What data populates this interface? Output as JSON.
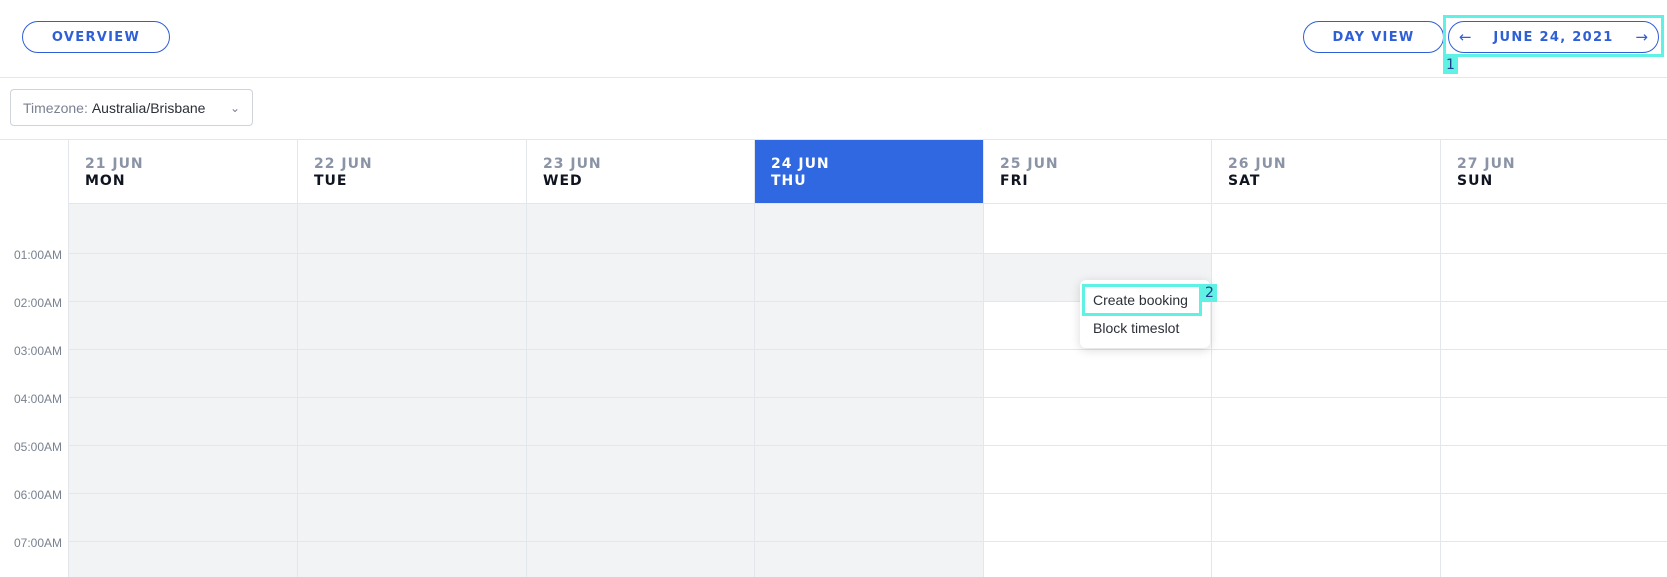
{
  "header": {
    "overview_label": "OVERVIEW",
    "dayview_label": "DAY VIEW",
    "date_label": "JUNE 24, 2021",
    "prev_arrow": "←",
    "next_arrow": "→"
  },
  "timezone": {
    "label": "Timezone:",
    "value": "Australia/Brisbane",
    "chevron": "⌄"
  },
  "days": [
    {
      "date": "21 JUN",
      "weekday": "MON"
    },
    {
      "date": "22 JUN",
      "weekday": "TUE"
    },
    {
      "date": "23 JUN",
      "weekday": "WED"
    },
    {
      "date": "24 JUN",
      "weekday": "THU"
    },
    {
      "date": "25 JUN",
      "weekday": "FRI"
    },
    {
      "date": "26 JUN",
      "weekday": "SAT"
    },
    {
      "date": "27 JUN",
      "weekday": "SUN"
    }
  ],
  "times": [
    "01:00AM",
    "02:00AM",
    "03:00AM",
    "04:00AM",
    "05:00AM",
    "06:00AM",
    "07:00AM"
  ],
  "context_menu": {
    "items": [
      "Create booking",
      "Block timeslot"
    ]
  },
  "annotations": [
    "1",
    "2"
  ],
  "colors": {
    "accent": "#2f5fd6",
    "today_bg": "#2f68e0",
    "past_bg": "#f2f3f5",
    "highlight": "#5ff2e4"
  }
}
